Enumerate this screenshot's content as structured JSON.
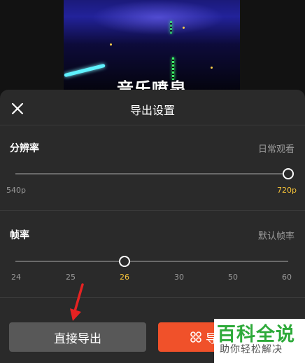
{
  "preview": {
    "caption": "音乐喷泉"
  },
  "header": {
    "title": "导出设置"
  },
  "resolution": {
    "label": "分辨率",
    "hint": "日常观看",
    "min_label": "540p",
    "max_label": "720p",
    "selected": "720p"
  },
  "framerate": {
    "label": "帧率",
    "hint": "默认帧率",
    "ticks": [
      "24",
      "25",
      "26",
      "30",
      "50",
      "60"
    ],
    "selected": "26"
  },
  "buttons": {
    "direct_export": "直接导出",
    "other_export": "导"
  },
  "watermark": {
    "main": "百科全说",
    "sub": "助你轻松解决"
  },
  "colors": {
    "accent": "#f5c238",
    "primary_button": "#f0512a",
    "arrow": "#e52222"
  }
}
